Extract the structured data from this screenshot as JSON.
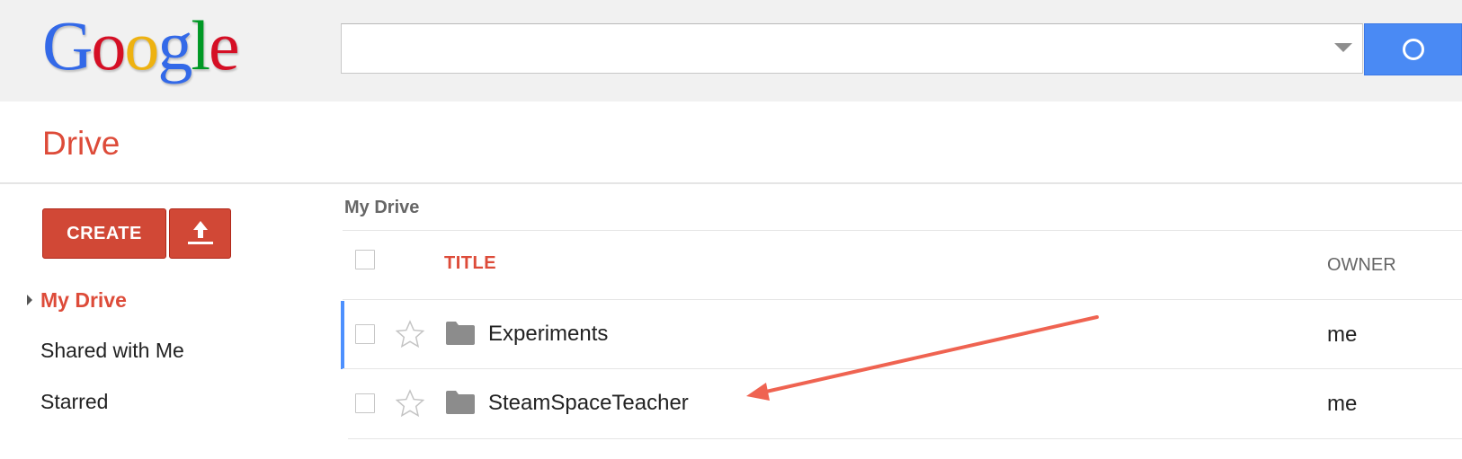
{
  "header": {
    "logo_letters": [
      "G",
      "o",
      "o",
      "g",
      "l",
      "e"
    ],
    "logo_colors": [
      "#3369e8",
      "#d50f25",
      "#eeb211",
      "#3369e8",
      "#009925",
      "#d50f25"
    ],
    "search": {
      "value": "",
      "placeholder": ""
    }
  },
  "app": {
    "title": "Drive"
  },
  "sidebar": {
    "create_label": "CREATE",
    "items": [
      {
        "label": "My Drive",
        "active": true
      },
      {
        "label": "Shared with Me",
        "active": false
      },
      {
        "label": "Starred",
        "active": false
      }
    ]
  },
  "main": {
    "breadcrumb": "My Drive",
    "columns": {
      "title": "TITLE",
      "owner": "OWNER"
    },
    "rows": [
      {
        "name": "Experiments",
        "owner": "me",
        "type": "folder-icon",
        "starred": false,
        "selected": true
      },
      {
        "name": "SteamSpaceTeacher",
        "owner": "me",
        "type": "folder-icon",
        "starred": false,
        "selected": false
      }
    ]
  },
  "colors": {
    "accent_red": "#dd4b39",
    "button_red": "#d14836",
    "search_blue": "#4a8af4",
    "selection_blue": "#4d90fe",
    "annotation_arrow": "#ef6351"
  }
}
